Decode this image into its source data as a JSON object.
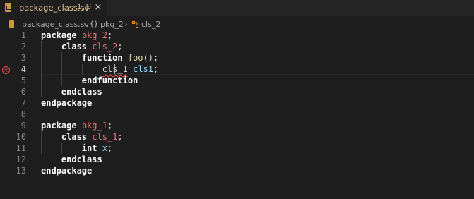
{
  "tab": {
    "filename": "package_class.sv",
    "status": "1, U",
    "close_glyph": "×",
    "file_icon": "systemverilog-file-icon"
  },
  "breadcrumb": {
    "file": "package_class.sv",
    "separator": "›",
    "package_symbol": "{}",
    "package": "pkg_2",
    "class": "cls_2"
  },
  "colors": {
    "background": "#1e1e1e",
    "keyword": "#ffffff",
    "identifier": "#f07178",
    "function": "#dcdcaa",
    "variable": "#9cdcfe",
    "error": "#f14c4c"
  },
  "editor": {
    "active_line": 4,
    "lines": [
      {
        "n": "1",
        "tokens": [
          {
            "t": "package",
            "c": "kw"
          },
          {
            "t": " ",
            "c": "plain"
          },
          {
            "t": "pkg_2",
            "c": "nm"
          },
          {
            "t": ";",
            "c": "plain"
          }
        ]
      },
      {
        "n": "2",
        "tokens": [
          {
            "t": "    ",
            "c": "plain"
          },
          {
            "t": "class",
            "c": "kw"
          },
          {
            "t": " ",
            "c": "plain"
          },
          {
            "t": "cls_2",
            "c": "nm"
          },
          {
            "t": ";",
            "c": "plain"
          }
        ]
      },
      {
        "n": "3",
        "tokens": [
          {
            "t": "        ",
            "c": "plain"
          },
          {
            "t": "function",
            "c": "kw"
          },
          {
            "t": " ",
            "c": "plain"
          },
          {
            "t": "foo",
            "c": "fn"
          },
          {
            "t": "();",
            "c": "plain"
          }
        ]
      },
      {
        "n": "4",
        "tokens": [
          {
            "t": "            ",
            "c": "plain"
          },
          {
            "t": "cls_1",
            "c": "plain error-word"
          },
          {
            "t": " ",
            "c": "plain"
          },
          {
            "t": "cls1",
            "c": "var"
          },
          {
            "t": ";",
            "c": "plain"
          }
        ]
      },
      {
        "n": "5",
        "tokens": [
          {
            "t": "        ",
            "c": "plain"
          },
          {
            "t": "endfunction",
            "c": "kw"
          }
        ]
      },
      {
        "n": "6",
        "tokens": [
          {
            "t": "    ",
            "c": "plain"
          },
          {
            "t": "endclass",
            "c": "kw"
          }
        ]
      },
      {
        "n": "7",
        "tokens": [
          {
            "t": "endpackage",
            "c": "kw"
          }
        ]
      },
      {
        "n": "8",
        "tokens": []
      },
      {
        "n": "9",
        "tokens": [
          {
            "t": "package",
            "c": "kw"
          },
          {
            "t": " ",
            "c": "plain"
          },
          {
            "t": "pkg_1",
            "c": "nm"
          },
          {
            "t": ";",
            "c": "plain"
          }
        ]
      },
      {
        "n": "10",
        "tokens": [
          {
            "t": "    ",
            "c": "plain"
          },
          {
            "t": "class",
            "c": "kw"
          },
          {
            "t": " ",
            "c": "plain"
          },
          {
            "t": "cls_1",
            "c": "nm"
          },
          {
            "t": ";",
            "c": "plain"
          }
        ]
      },
      {
        "n": "11",
        "tokens": [
          {
            "t": "        ",
            "c": "plain"
          },
          {
            "t": "int",
            "c": "kw"
          },
          {
            "t": " ",
            "c": "plain"
          },
          {
            "t": "x",
            "c": "var"
          },
          {
            "t": ";",
            "c": "plain"
          }
        ]
      },
      {
        "n": "12",
        "tokens": [
          {
            "t": "    ",
            "c": "plain"
          },
          {
            "t": "endclass",
            "c": "kw"
          }
        ]
      },
      {
        "n": "13",
        "tokens": [
          {
            "t": "endpackage",
            "c": "kw"
          }
        ]
      }
    ]
  }
}
